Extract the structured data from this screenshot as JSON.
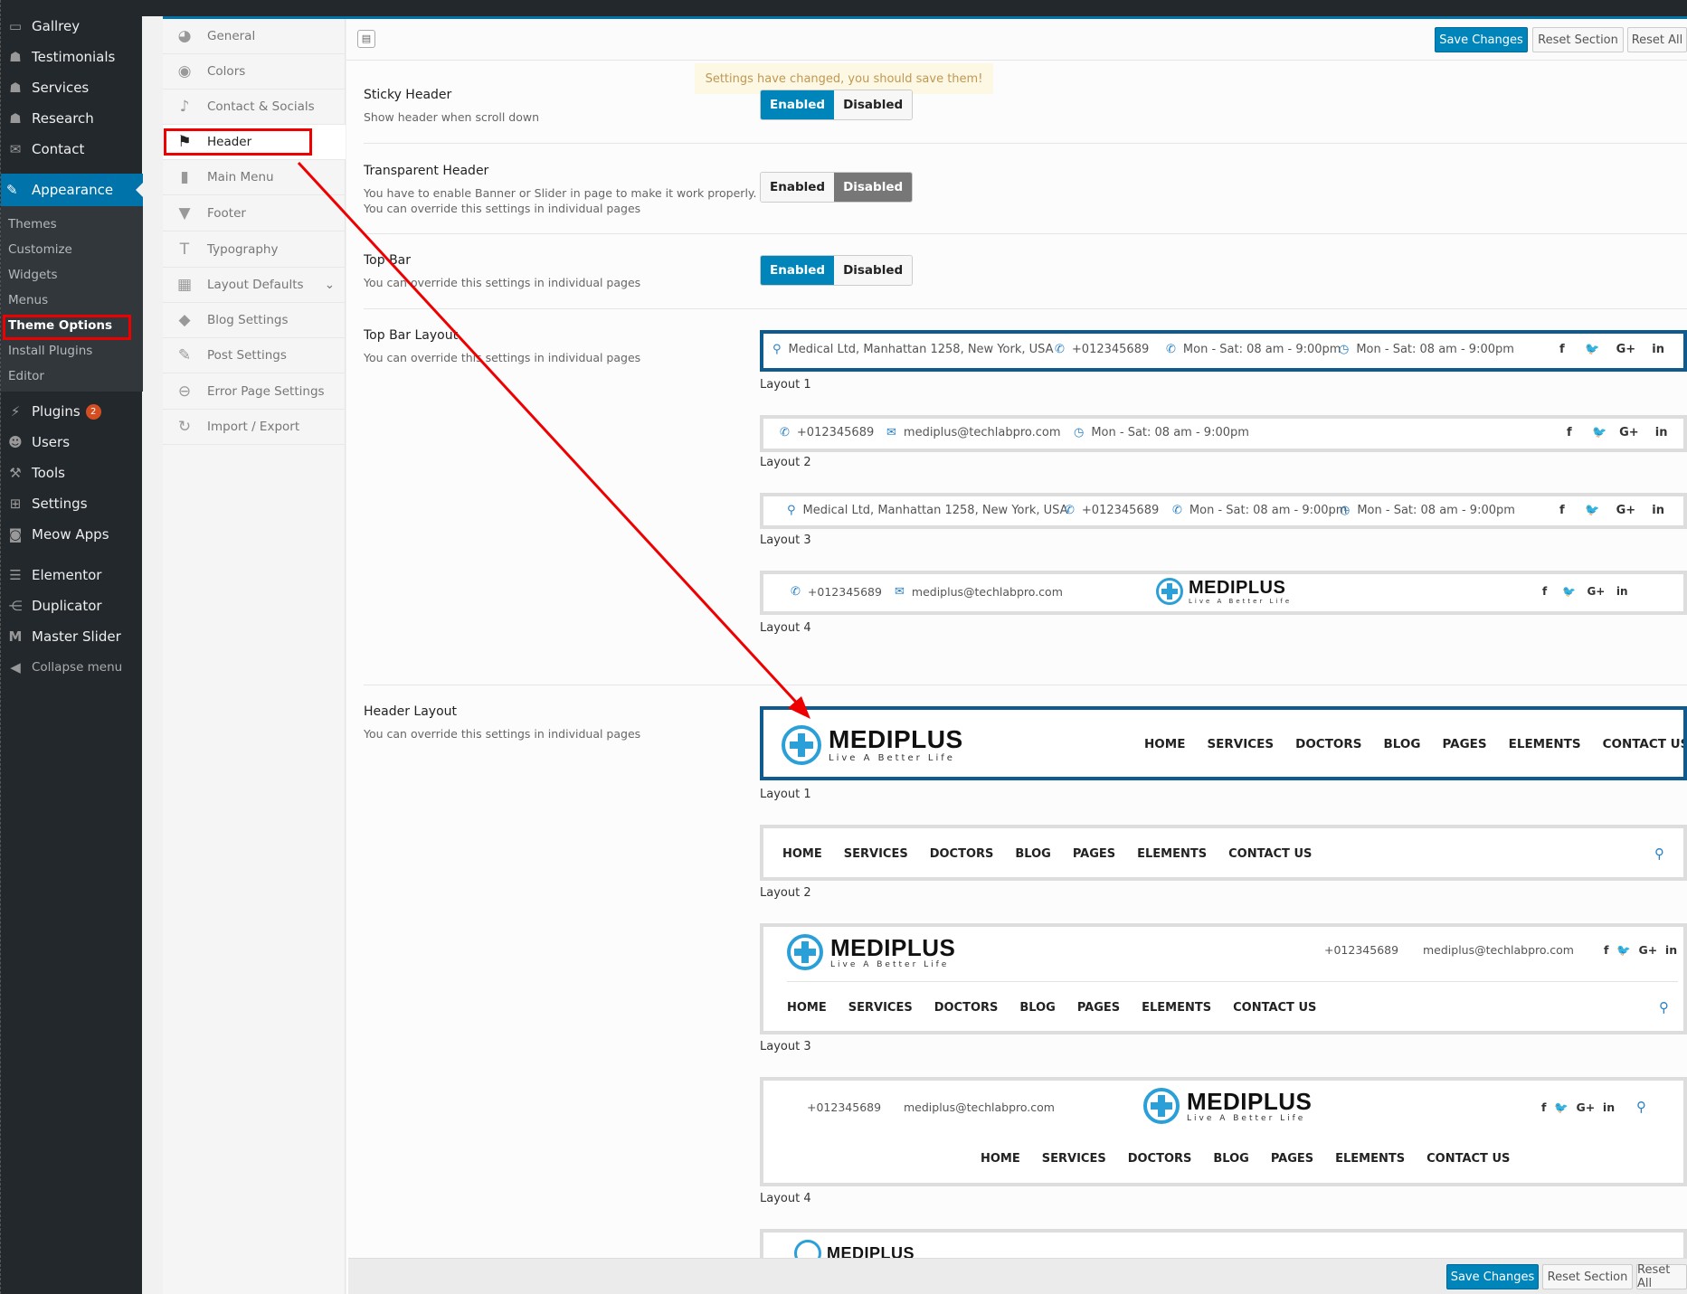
{
  "wp_menu": {
    "items": [
      {
        "label": "Gallrey",
        "icon": "folder-icon"
      },
      {
        "label": "Testimonials",
        "icon": "user-icon"
      },
      {
        "label": "Services",
        "icon": "user-icon"
      },
      {
        "label": "Research",
        "icon": "user-icon"
      },
      {
        "label": "Contact",
        "icon": "mail-icon"
      }
    ],
    "appearance": "Appearance",
    "appearance_sub": [
      "Themes",
      "Customize",
      "Widgets",
      "Menus",
      "Theme Options",
      "Install Plugins",
      "Editor"
    ],
    "lower": [
      {
        "label": "Plugins",
        "icon": "plugin-icon",
        "badge": "2"
      },
      {
        "label": "Users",
        "icon": "users-icon"
      },
      {
        "label": "Tools",
        "icon": "wrench-icon"
      },
      {
        "label": "Settings",
        "icon": "settings-icon"
      },
      {
        "label": "Meow Apps",
        "icon": "camera-icon"
      },
      {
        "label": "Elementor",
        "icon": "elementor-icon"
      },
      {
        "label": "Duplicator",
        "icon": "share-icon"
      },
      {
        "label": "Master Slider",
        "icon": "slider-icon"
      },
      {
        "label": "Collapse menu",
        "icon": "collapse-icon"
      }
    ]
  },
  "options_nav": [
    {
      "label": "General",
      "icon": "globe-icon"
    },
    {
      "label": "Colors",
      "icon": "eye-icon"
    },
    {
      "label": "Contact & Socials",
      "icon": "twitter-icon"
    },
    {
      "label": "Header",
      "icon": "flag-icon"
    },
    {
      "label": "Main Menu",
      "icon": "book-icon"
    },
    {
      "label": "Footer",
      "icon": "triangle-icon"
    },
    {
      "label": "Typography",
      "icon": "text-icon"
    },
    {
      "label": "Layout Defaults",
      "icon": "grid-icon"
    },
    {
      "label": "Blog Settings",
      "icon": "tags-icon"
    },
    {
      "label": "Post Settings",
      "icon": "edit-icon"
    },
    {
      "label": "Error Page Settings",
      "icon": "minus-circle-icon"
    },
    {
      "label": "Import / Export",
      "icon": "refresh-icon"
    }
  ],
  "toolbar": {
    "save": "Save Changes",
    "reset_section": "Reset Section",
    "reset_all": "Reset All"
  },
  "notice": "Settings have changed, you should save them!",
  "sections": {
    "sticky": {
      "title": "Sticky Header",
      "desc": "Show header when scroll down",
      "on": "Enabled",
      "off": "Disabled"
    },
    "transparent": {
      "title": "Transparent Header",
      "desc1": "You have to enable Banner or Slider in page to make it work properly.",
      "desc2": "You can override this settings in individual pages",
      "on": "Enabled",
      "off": "Disabled"
    },
    "topbar": {
      "title": "Top Bar",
      "desc": "You can override this settings in individual pages",
      "on": "Enabled",
      "off": "Disabled"
    },
    "topbar_layout": {
      "title": "Top Bar Layout",
      "desc": "You can override this settings in individual pages"
    },
    "header_layout": {
      "title": "Header Layout",
      "desc": "You can override this settings in individual pages"
    }
  },
  "topbar_previews": {
    "address": "Medical Ltd, Manhattan 1258, New York, USA",
    "phone": "+012345689",
    "hours": "Mon - Sat: 08 am - 9:00pm",
    "email": "mediplus@techlabpro.com",
    "labels": [
      "Layout 1",
      "Layout 2",
      "Layout 3",
      "Layout 4"
    ],
    "social": {
      "fb": "f",
      "tw": "🐦",
      "gp": "G+",
      "li": "in"
    }
  },
  "header_previews": {
    "brand": "MEDIPLUS",
    "tagline": "Live A Better Life",
    "nav": [
      "HOME",
      "SERVICES",
      "DOCTORS",
      "BLOG",
      "PAGES",
      "ELEMENTS",
      "CONTACT US"
    ],
    "labels": [
      "Layout 1",
      "Layout 2",
      "Layout 3",
      "Layout 4"
    ],
    "phone": "+012345689",
    "email": "mediplus@techlabpro.com"
  },
  "colors": {
    "accent": "#0085ba",
    "selected_border": "#0f5a8e",
    "highlight": "#ee0000"
  }
}
